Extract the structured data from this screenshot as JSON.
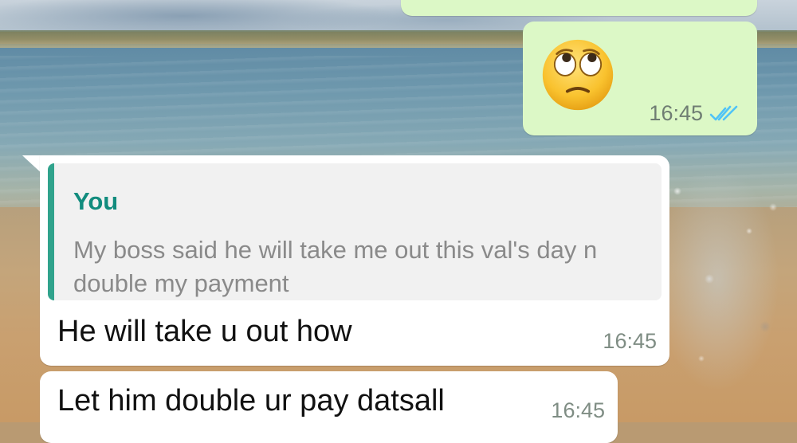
{
  "chat": {
    "messages": [
      {
        "direction": "outgoing",
        "type": "text",
        "text": "",
        "status": "cut-off"
      },
      {
        "direction": "outgoing",
        "type": "emoji",
        "emoji": "face-with-rolling-eyes",
        "time": "16:45",
        "status_icon": "double-check-read-icon"
      },
      {
        "direction": "incoming",
        "type": "reply",
        "quoted": {
          "author": "You",
          "text": "My boss said he will take me out this val's day n double my payment"
        },
        "text": "He will take u out how",
        "time": "16:45"
      },
      {
        "direction": "incoming",
        "type": "text",
        "text": "Let him double ur pay datsall",
        "time": "16:45"
      }
    ]
  },
  "colors": {
    "outgoing_bubble": "#dcf8c6",
    "incoming_bubble": "#ffffff",
    "quote_accent": "#30a38c",
    "quote_author": "#128c7e",
    "read_ticks": "#4fc3f7"
  }
}
